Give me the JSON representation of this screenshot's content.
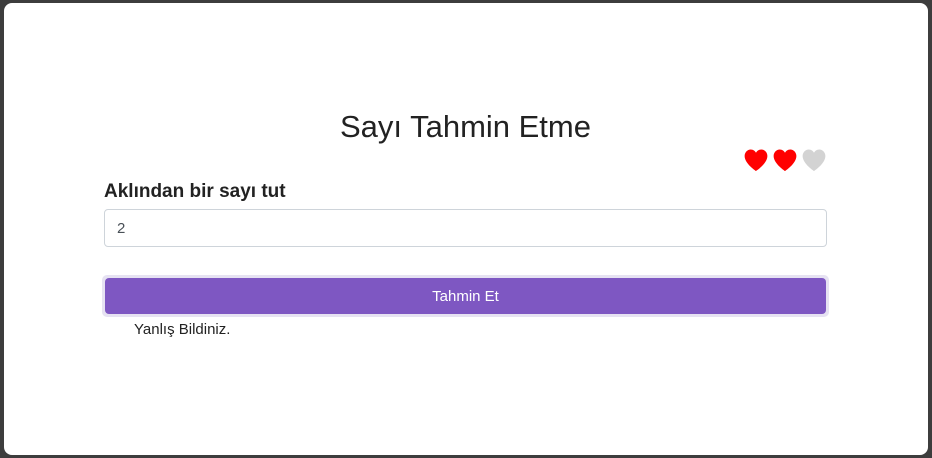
{
  "page": {
    "title": "Sayı Tahmin Etme"
  },
  "lives": {
    "total": 3,
    "remaining": 2,
    "full_color": "#ff0000",
    "empty_color": "#d3d3d3",
    "icon": "heart-icon"
  },
  "form": {
    "label": "Aklından bir sayı tut",
    "input_value": "2",
    "button_label": "Tahmin Et",
    "accent_color": "#7e57c2"
  },
  "result": {
    "message": "Yanlış Bildiniz."
  }
}
